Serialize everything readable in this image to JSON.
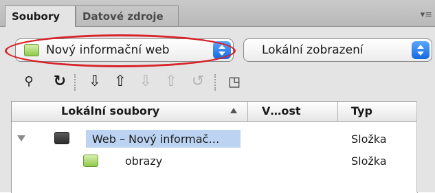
{
  "tabs": [
    {
      "label": "Soubory",
      "active": true
    },
    {
      "label": "Datové zdroje",
      "active": false
    }
  ],
  "panel_menu_icon": "panel-menu-icon",
  "site_select": {
    "value": "Nový informační web",
    "icon": "site-folder-icon"
  },
  "view_select": {
    "value": "Lokální zobrazení"
  },
  "toolbar_icons": [
    "connect-icon",
    "refresh-icon",
    "get-files-icon",
    "put-files-icon",
    "check-out-icon",
    "check-in-icon",
    "synchronize-icon",
    "expand-icon"
  ],
  "columns": {
    "name": "Lokální soubory",
    "size": "V…ost",
    "type": "Typ"
  },
  "rows": [
    {
      "name": "Web – Nový informač…",
      "type": "Složka",
      "selected": true,
      "expanded": true
    },
    {
      "name": "obrazy",
      "type": "Složka",
      "selected": false
    }
  ],
  "colors": {
    "accent": "#1668e0",
    "highlight_ring": "#d8232a",
    "selection": "#bcd3f1"
  }
}
